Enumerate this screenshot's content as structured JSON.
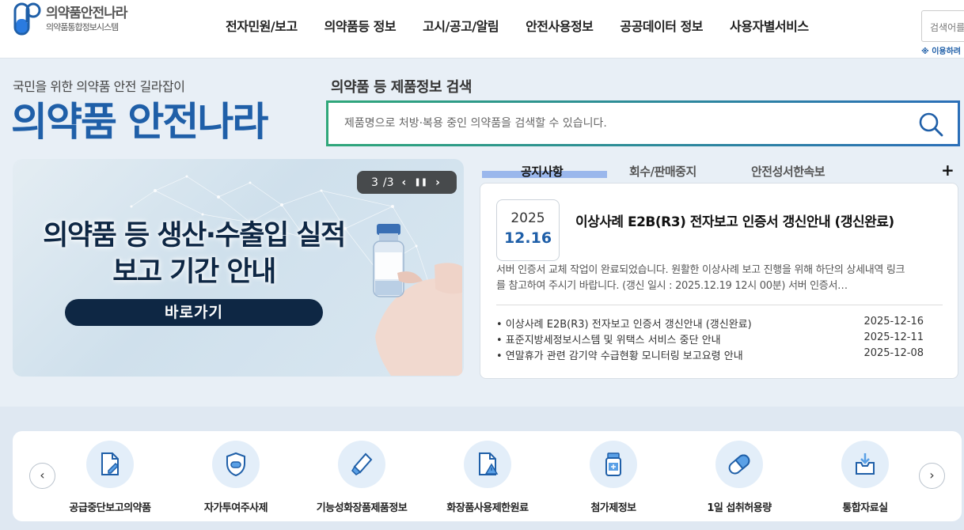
{
  "header": {
    "logo_main": "의약품안전나라",
    "logo_sub": "의약품통합정보시스템",
    "nav": [
      "전자민원/보고",
      "의약품등 정보",
      "고시/공고/알림",
      "안전사용정보",
      "공공데이터 정보",
      "사용자별서비스"
    ],
    "search_text": "검색어를",
    "search_hint": "※ 이용하려"
  },
  "hero": {
    "tagline": "국민을 위한 의약품 안전 길라잡이",
    "brand": "의약품 안전나라",
    "search_title": "의약품 등 제품정보 검색",
    "search_placeholder": "제품명으로 처방·복용 중인 의약품을 검색할 수 있습니다."
  },
  "banner": {
    "headline_line1": "의약품 등 생산·수출입 실적",
    "headline_line2": "보고 기간 안내",
    "button": "바로가기",
    "current": "3",
    "total": "/3",
    "prev_symbol": "‹",
    "pause_symbol": "❚❚",
    "next_symbol": "›"
  },
  "notice": {
    "tabs": [
      "공지사항",
      "회수/판매중지",
      "안전성서한속보"
    ],
    "more": "+",
    "featured": {
      "year": "2025",
      "md": "12.16",
      "title": "이상사례 E2B(R3) 전자보고 인증서 갱신안내 (갱신완료)",
      "body": "서버 인증서 교체 작업이 완료되었습니다.   원활한 이상사례 보고 진행을 위해 하단의 상세내역 링크를 참고하여 주시기 바랍니다.   (갱신 일시 : 2025.12.19 12시 00분)   서버 인증서…"
    },
    "items": [
      {
        "title": "• 이상사례 E2B(R3) 전자보고 인증서 갱신안내 (갱신완료)",
        "date": "2025-12-16"
      },
      {
        "title": "• 표준지방세정보시스템 및 위택스 서비스 중단 안내",
        "date": "2025-12-11"
      },
      {
        "title": "• 연말휴가 관련 감기약 수급현황 모니터링 보고요령 안내",
        "date": "2025-12-08"
      }
    ]
  },
  "quick": {
    "prev": "‹",
    "next": "›",
    "items": [
      {
        "label": "공급중단보고의약품",
        "icon": "document-edit-icon"
      },
      {
        "label": "자가투여주사제",
        "icon": "shield-pill-icon"
      },
      {
        "label": "기능성화장품제품정보",
        "icon": "cosmetic-tube-icon"
      },
      {
        "label": "화장품사용제한원료",
        "icon": "document-warning-icon"
      },
      {
        "label": "첨가제정보",
        "icon": "medicine-bottle-icon"
      },
      {
        "label": "1일 섭취허용량",
        "icon": "capsule-icon"
      },
      {
        "label": "통합자료실",
        "icon": "download-box-icon"
      }
    ]
  },
  "colors": {
    "brand_blue": "#1f5fa8",
    "navy": "#0e2744",
    "tab_highlight": "#9ab7ec",
    "search_gradient_start": "#2fa77a",
    "search_gradient_end": "#2b6fb8"
  }
}
